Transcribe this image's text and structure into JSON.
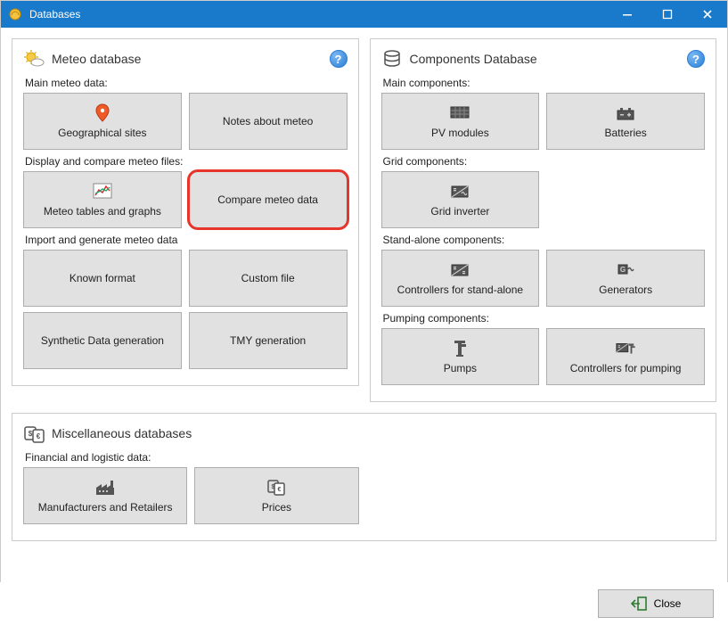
{
  "window": {
    "title": "Databases"
  },
  "meteo": {
    "title": "Meteo database",
    "sections": {
      "main": {
        "label": "Main meteo data:",
        "geo_sites": "Geographical sites",
        "notes": "Notes about meteo"
      },
      "display": {
        "label": "Display and compare meteo files:",
        "tables": "Meteo tables and graphs",
        "compare": "Compare meteo data"
      },
      "import": {
        "label": "Import and generate meteo data",
        "known": "Known format",
        "custom": "Custom file",
        "synthetic": "Synthetic Data generation",
        "tmy": "TMY generation"
      }
    }
  },
  "components": {
    "title": "Components Database",
    "sections": {
      "main": {
        "label": "Main components:",
        "pv": "PV modules",
        "batt": "Batteries"
      },
      "grid": {
        "label": "Grid components:",
        "inv": "Grid inverter"
      },
      "standalone": {
        "label": "Stand-alone components:",
        "ctrl": "Controllers for stand-alone",
        "gen": "Generators"
      },
      "pump": {
        "label": "Pumping components:",
        "pumps": "Pumps",
        "ctrl": "Controllers for pumping"
      }
    }
  },
  "misc": {
    "title": "Miscellaneous databases",
    "section": {
      "label": "Financial and logistic data:",
      "manuf": "Manufacturers and Retailers",
      "prices": "Prices"
    }
  },
  "footer": {
    "close": "Close"
  },
  "help": "?"
}
